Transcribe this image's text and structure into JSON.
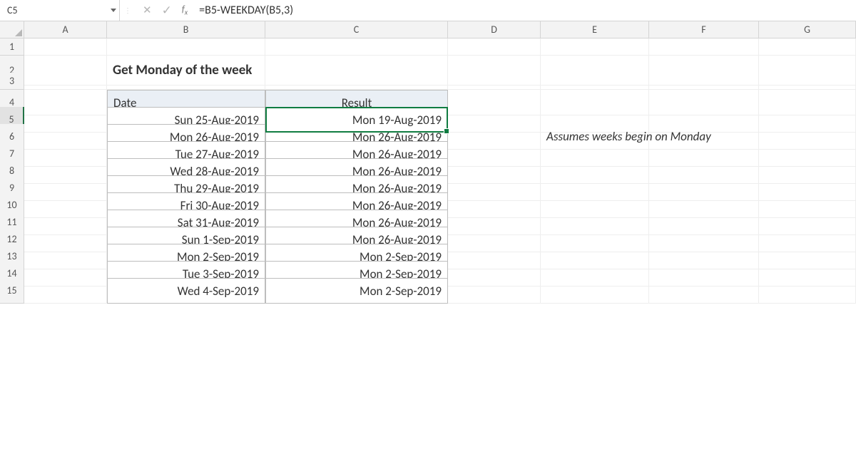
{
  "name_box": "C5",
  "formula": "=B5-WEEKDAY(B5,3)",
  "columns": [
    "A",
    "B",
    "C",
    "D",
    "E",
    "F",
    "G"
  ],
  "rows": [
    "1",
    "2",
    "3",
    "4",
    "5",
    "6",
    "7",
    "8",
    "9",
    "10",
    "11",
    "12",
    "13",
    "14",
    "15"
  ],
  "title": "Get Monday of the week",
  "headers": {
    "date": "Date",
    "result": "Result"
  },
  "note": "Assumes weeks begin on Monday",
  "table": [
    {
      "date": "Sun 25-Aug-2019",
      "result": "Mon 19-Aug-2019"
    },
    {
      "date": "Mon 26-Aug-2019",
      "result": "Mon 26-Aug-2019"
    },
    {
      "date": "Tue 27-Aug-2019",
      "result": "Mon 26-Aug-2019"
    },
    {
      "date": "Wed 28-Aug-2019",
      "result": "Mon 26-Aug-2019"
    },
    {
      "date": "Thu 29-Aug-2019",
      "result": "Mon 26-Aug-2019"
    },
    {
      "date": "Fri 30-Aug-2019",
      "result": "Mon 26-Aug-2019"
    },
    {
      "date": "Sat 31-Aug-2019",
      "result": "Mon 26-Aug-2019"
    },
    {
      "date": "Sun 1-Sep-2019",
      "result": "Mon 26-Aug-2019"
    },
    {
      "date": "Mon 2-Sep-2019",
      "result": "Mon 2-Sep-2019"
    },
    {
      "date": "Tue 3-Sep-2019",
      "result": "Mon 2-Sep-2019"
    },
    {
      "date": "Wed 4-Sep-2019",
      "result": "Mon 2-Sep-2019"
    }
  ],
  "selected_cell": "C5"
}
